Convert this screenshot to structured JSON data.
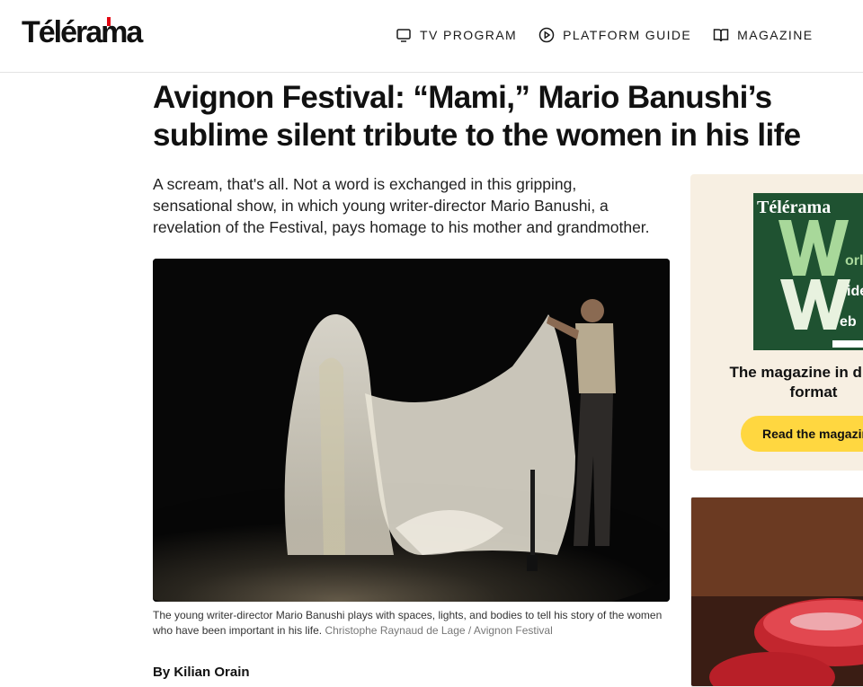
{
  "site": {
    "logo_text": "Télérama"
  },
  "nav": {
    "items": [
      {
        "label": "TV PROGRAM",
        "icon": "tv-icon"
      },
      {
        "label": "PLATFORM GUIDE",
        "icon": "play-icon"
      },
      {
        "label": "MAGAZINE",
        "icon": "book-icon"
      }
    ]
  },
  "article": {
    "title": "Avignon Festival: “Mami,” Mario Banushi’s sublime silent tribute to the women in his life",
    "lede": "A scream, that's all. Not a word is exchanged in this gripping, sensational show, in which young writer-director Mario Banushi, a revelation of the Festival, pays homage to his mother and grandmother.",
    "caption": "The young writer-director Mario Banushi plays with spaces, lights, and bodies to tell his story of the women who have been important in his life.",
    "credit": "Christophe Raynaud de Lage / Avignon Festival",
    "byline": "By Kilian Orain"
  },
  "promo": {
    "cover_brand": "Télérama",
    "cover_words": [
      "orld",
      "ide",
      "eb"
    ],
    "title": "The magazine in digital format",
    "button_label": "Read the magazine"
  },
  "colors": {
    "brand_red": "#e30613",
    "button_yellow": "#ffd740",
    "promo_bg": "#f7efe2",
    "cover_green": "#1f5231"
  }
}
